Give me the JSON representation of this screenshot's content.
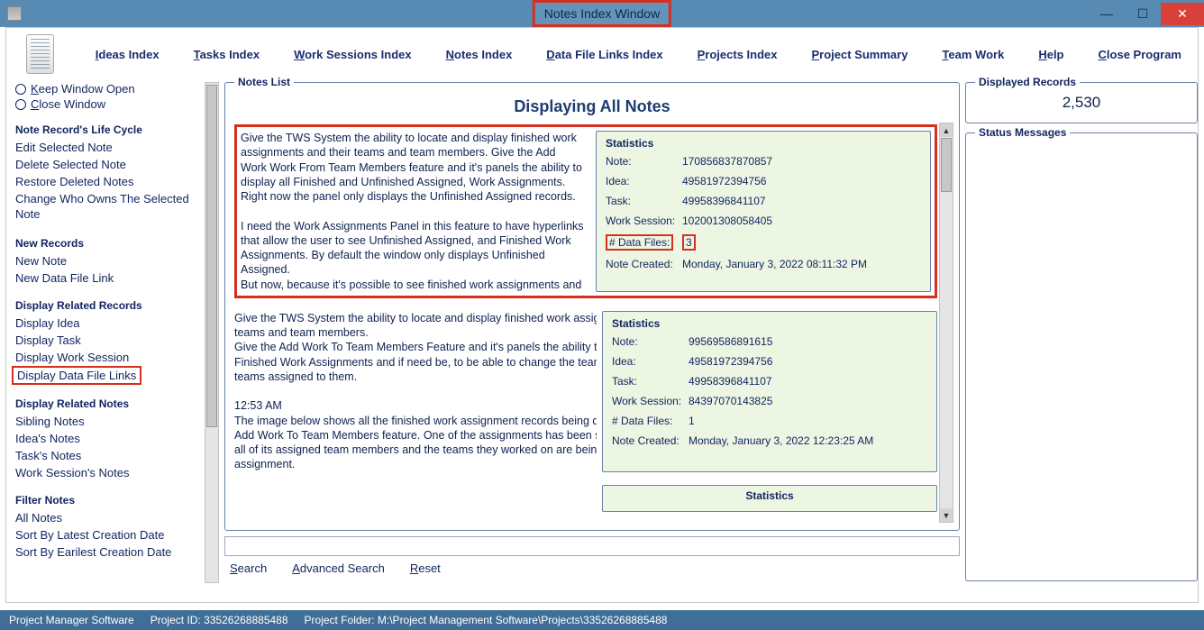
{
  "window": {
    "title": "Notes Index Window"
  },
  "menu": {
    "ideas": "Ideas Index",
    "tasks": "Tasks Index",
    "work": "Work Sessions Index",
    "notes": "Notes Index",
    "dfl": "Data File Links Index",
    "projects": "Projects Index",
    "summary": "Project Summary",
    "team": "Team Work",
    "help": "Help",
    "close": "Close Program"
  },
  "sidebar": {
    "keep_open": "Keep Window Open",
    "close_window": "Close Window",
    "life_cycle_h": "Note Record's Life Cycle",
    "edit": "Edit Selected Note",
    "delete": "Delete Selected Note",
    "restore": "Restore Deleted Notes",
    "change_owner": "Change Who Owns The Selected Note",
    "new_records_h": "New Records",
    "new_note": "New Note",
    "new_dfl": "New Data File Link",
    "related_h": "Display Related Records",
    "d_idea": "Display Idea",
    "d_task": "Display Task",
    "d_work": "Display Work Session",
    "d_dfl": "Display Data File Links",
    "related_notes_h": "Display Related Notes",
    "sibling": "Sibling Notes",
    "idea_notes": "Idea's Notes",
    "task_notes": "Task's Notes",
    "ws_notes": "Work Session's Notes",
    "filter_h": "Filter Notes",
    "all_notes": "All Notes",
    "sort_latest": "Sort By Latest Creation Date",
    "sort_earliest": "Sort By Earilest Creation Date"
  },
  "notes_list": {
    "panel_title": "Notes List",
    "display_title": "Displaying All Notes"
  },
  "stats_labels": {
    "title": "Statistics",
    "note": "Note:",
    "idea": "Idea:",
    "task": "Task:",
    "work": "Work Session:",
    "files": "# Data Files:",
    "created": "Note Created:"
  },
  "note1": {
    "l1": "Give the TWS System the ability to locate and display finished work",
    "l2": "assignments and their teams and team members.  Give the Add",
    "l3": "Work Work From Team Members feature and it's panels the ability to",
    "l4": "display all Finished and Unfinished Assigned,  Work Assignments.",
    "l5": "Right now the panel only displays the Unfinished Assigned records.",
    "l7": "I need the Work Assignments Panel in this feature to have hyperlinks",
    "l8": "that allow the user to see Unfinished Assigned, and Finished Work",
    "l9": "Assignments. By default the window only displays Unfinished",
    "l10": "Assigned.",
    "l11": "But now, because it's possible to see finished work assignments and",
    "stats": {
      "note": "170856837870857",
      "idea": "49581972394756",
      "task": "49958396841107",
      "work": "102001308058405",
      "files": "3",
      "created": "Monday, January 3, 2022   08:11:32 PM"
    }
  },
  "note2": {
    "l1": "Give the TWS System the ability to locate and display finished work assignments, and their",
    "l2": "teams and team members.",
    "l3": "Give the Add Work To Team Members Feature and it's panels the ability to locate and display",
    "l4": "Finished Work Assignments and if need be, to be able to change the team members and",
    "l5": "teams assigned to them.",
    "l7": "12:53 AM",
    "l8": "The image below shows all the finished work assignment records being displayed in the",
    "l9": "Add Work To Team Members feature. One of the assignments has been selected and",
    "l10": "all of its assigned team members and the teams they worked on are being displayed for that",
    "l11": "assignment.",
    "stats": {
      "note": "99569586891615",
      "idea": "49581972394756",
      "task": "49958396841107",
      "work": "84397070143825",
      "files": "1",
      "created": "Monday, January 3, 2022   12:23:25 AM"
    }
  },
  "search": {
    "search": "Search",
    "adv": "Advanced Search",
    "reset": "Reset",
    "placeholder": ""
  },
  "right": {
    "records_title": "Displayed Records",
    "records_value": "2,530",
    "status_title": "Status Messages"
  },
  "footer": {
    "app": "Project Manager Software",
    "pid": "Project ID:  33526268885488",
    "folder": "Project Folder:  M:\\Project Management Software\\Projects\\33526268885488"
  }
}
